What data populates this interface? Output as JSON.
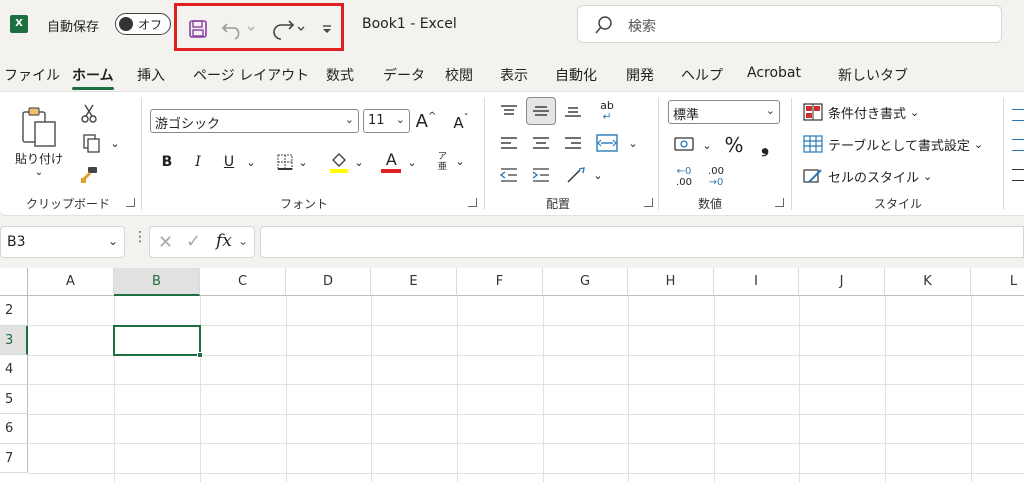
{
  "titlebar": {
    "app_icon_letter": "X",
    "autosave_label": "自動保存",
    "autosave_state": "オフ",
    "doc_title": "Book1  -  Excel",
    "search_placeholder": "検索",
    "qat_icons": [
      "save-icon",
      "undo-icon",
      "redo-icon",
      "customize-qat-icon"
    ]
  },
  "tabs": [
    "ファイル",
    "ホーム",
    "挿入",
    "ページ レイアウト",
    "数式",
    "データ",
    "校閲",
    "表示",
    "自動化",
    "開発",
    "ヘルプ",
    "Acrobat",
    "新しいタブ"
  ],
  "active_tab": "ホーム",
  "ribbon": {
    "clipboard": {
      "paste_label": "貼り付け",
      "group_label": "クリップボード"
    },
    "font": {
      "font_name": "游ゴシック",
      "font_size": "11",
      "bold": "B",
      "italic": "I",
      "underline": "U",
      "font_color_letter": "A",
      "grow_letter": "A",
      "shrink_letter": "A",
      "phonetic": "ア亜",
      "group_label": "フォント",
      "highlight_color": "#ffff00",
      "font_color": "#e02020"
    },
    "alignment": {
      "group_label": "配置",
      "wrap_text": "ab"
    },
    "number": {
      "format": "標準",
      "percent": "%",
      "comma": "❟",
      "inc_decimal": ".00",
      "dec_decimal": ".00",
      "group_label": "数値"
    },
    "styles": {
      "conditional": "条件付き書式",
      "table": "テーブルとして書式設定",
      "cell_styles": "セルのスタイル",
      "group_label": "スタイル"
    }
  },
  "formula_bar": {
    "name_box": "B3",
    "fx_label": "fx",
    "formula": ""
  },
  "grid": {
    "columns": [
      "A",
      "B",
      "C",
      "D",
      "E",
      "F",
      "G",
      "H",
      "I",
      "J",
      "K",
      "L"
    ],
    "rows": [
      "2",
      "3",
      "4",
      "5",
      "6",
      "7"
    ],
    "selected_column": "B",
    "selected_row": "3"
  },
  "colors": {
    "accent": "#1d6f42",
    "qat_highlight": "#e02020"
  }
}
